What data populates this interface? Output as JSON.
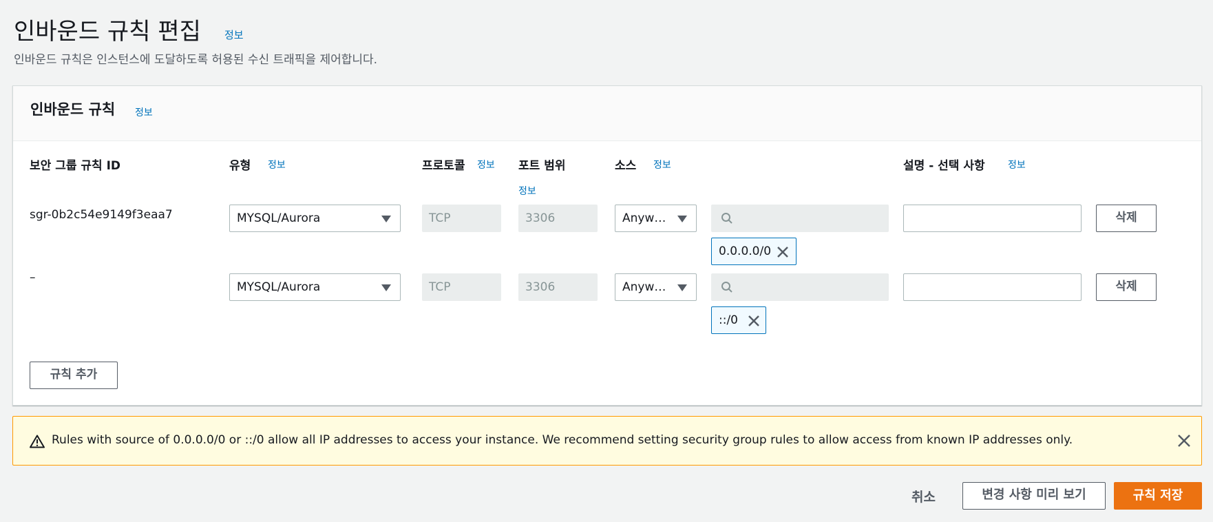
{
  "page": {
    "title": "인바운드 규칙 편집",
    "info": "정보",
    "subtitle": "인바운드 규칙은 인스턴스에 도달하도록 허용된 수신 트래픽을 제어합니다."
  },
  "panel": {
    "title": "인바운드 규칙",
    "info": "정보",
    "columns": {
      "rule_id": "보안 그룹 규칙 ID",
      "type": "유형",
      "protocol": "프로토콜",
      "port_range": "포트 범위",
      "source": "소스",
      "description": "설명 - 선택 사항",
      "info": "정보"
    },
    "rules": [
      {
        "id": "sgr-0b2c54e9149f3eaa7",
        "type": "MYSQL/Aurora",
        "protocol": "TCP",
        "port": "3306",
        "source": "Anyw…",
        "search_value": "",
        "token": "0.0.0.0/0",
        "description": "",
        "delete_label": "삭제"
      },
      {
        "id": "–",
        "type": "MYSQL/Aurora",
        "protocol": "TCP",
        "port": "3306",
        "source": "Anyw…",
        "search_value": "",
        "token": "::/0",
        "description": "",
        "delete_label": "삭제"
      }
    ],
    "add_rule_label": "규칙 추가"
  },
  "alert": {
    "text": "Rules with source of 0.0.0.0/0 or ::/0 allow all IP addresses to access your instance. We recommend setting security group rules to allow access from known IP addresses only.",
    "icon": "warning-icon",
    "close_icon": "close-icon",
    "border_color": "#ff9900",
    "background": "#fffce0"
  },
  "footer": {
    "cancel_label": "취소",
    "preview_label": "변경 사항 미리 보기",
    "save_label": "규칙 저장",
    "save_color": "#ec7211"
  }
}
